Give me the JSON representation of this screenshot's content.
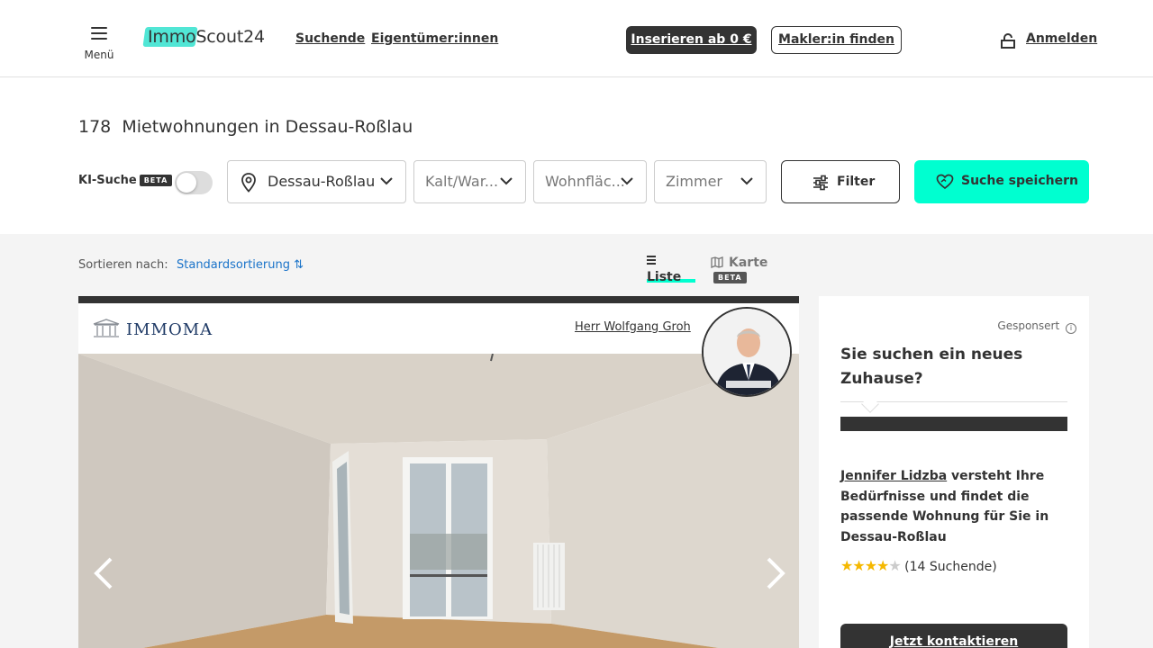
{
  "header": {
    "menu_label": "Menü",
    "logo_text": "ImmoScout24",
    "nav": [
      "Suchende",
      "Eigentümer:innen"
    ],
    "insert_button": "Inserieren ab 0 €",
    "broker_button": "Makler:in finden",
    "login_label": "Anmelden"
  },
  "search": {
    "result_title": "178  Mietwohnungen in Dessau-Roßlau",
    "ki_label": "KI-Suche",
    "ki_badge": "BETA",
    "ki_enabled": false,
    "location": "Dessau-Roßlau",
    "rent_placeholder": "Kalt/War...",
    "area_placeholder": "Wohnfläc...",
    "rooms_placeholder": "Zimmer",
    "filter_label": "Filter",
    "save_label": "Suche speichern"
  },
  "sort": {
    "label": "Sortieren nach:",
    "value": "Standardsortierung ⇅"
  },
  "views": {
    "list": "Liste",
    "map": "Karte",
    "map_badge": "BETA"
  },
  "listing": {
    "agency_name": "IMMOMA",
    "agent_name": "Herr Wolfgang Groh"
  },
  "ad": {
    "sponsored": "Gesponsert",
    "headline": "Sie suchen ein neues Zuhause?",
    "agent_link": "Jennifer Lidzba",
    "desc_rest": " versteht Ihre Bedürfnisse und findet die passende Wohnung für Sie in Dessau-Roßlau",
    "rating": 4,
    "rating_text": "(14 Suchende)",
    "contact_button": "Jetzt kontaktieren"
  },
  "colors": {
    "accent": "#00ffd0",
    "dark": "#333333",
    "link": "#1a73c9"
  }
}
